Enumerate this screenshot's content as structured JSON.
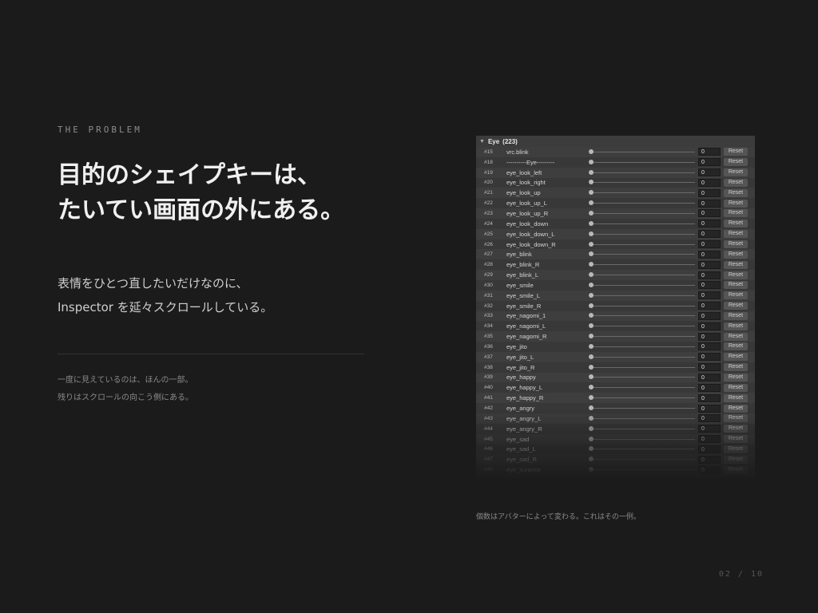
{
  "eyebrow": "THE PROBLEM",
  "headline": {
    "line1": "目的のシェイプキーは、",
    "line2": "たいてい画面の外にある。"
  },
  "lead": {
    "line1": "表情をひとつ直したいだけなのに、",
    "line2": "Inspector を延々スクロールしている。"
  },
  "note": {
    "line1": "一度に見えているのは、ほんの一部。",
    "line2": "残りはスクロールの向こう側にある。"
  },
  "inspector": {
    "group_name": "Eye",
    "group_count": "(223)",
    "reset_label": "Reset",
    "rows": [
      {
        "index": "#15",
        "name": "vrc.blink",
        "value": "0"
      },
      {
        "index": "#18",
        "name": "----------Eye---------",
        "value": "0"
      },
      {
        "index": "#19",
        "name": "eye_look_left",
        "value": "0"
      },
      {
        "index": "#20",
        "name": "eye_look_right",
        "value": "0"
      },
      {
        "index": "#21",
        "name": "eye_look_up",
        "value": "0"
      },
      {
        "index": "#22",
        "name": "eye_look_up_L",
        "value": "0"
      },
      {
        "index": "#23",
        "name": "eye_look_up_R",
        "value": "0"
      },
      {
        "index": "#24",
        "name": "eye_look_down",
        "value": "0"
      },
      {
        "index": "#25",
        "name": "eye_look_down_L",
        "value": "0"
      },
      {
        "index": "#26",
        "name": "eye_look_down_R",
        "value": "0"
      },
      {
        "index": "#27",
        "name": "eye_blink",
        "value": "0"
      },
      {
        "index": "#28",
        "name": "eye_blink_R",
        "value": "0"
      },
      {
        "index": "#29",
        "name": "eye_blink_L",
        "value": "0"
      },
      {
        "index": "#30",
        "name": "eye_smile",
        "value": "0"
      },
      {
        "index": "#31",
        "name": "eye_smile_L",
        "value": "0"
      },
      {
        "index": "#32",
        "name": "eye_smile_R",
        "value": "0"
      },
      {
        "index": "#33",
        "name": "eye_nagomi_1",
        "value": "0"
      },
      {
        "index": "#34",
        "name": "eye_nagomi_L",
        "value": "0"
      },
      {
        "index": "#35",
        "name": "eye_nagomi_R",
        "value": "0"
      },
      {
        "index": "#36",
        "name": "eye_jito",
        "value": "0"
      },
      {
        "index": "#37",
        "name": "eye_jito_L",
        "value": "0"
      },
      {
        "index": "#38",
        "name": "eye_jito_R",
        "value": "0"
      },
      {
        "index": "#39",
        "name": "eye_happy",
        "value": "0"
      },
      {
        "index": "#40",
        "name": "eye_happy_L",
        "value": "0"
      },
      {
        "index": "#41",
        "name": "eye_happy_R",
        "value": "0"
      },
      {
        "index": "#42",
        "name": "eye_angry",
        "value": "0"
      },
      {
        "index": "#43",
        "name": "eye_angry_L",
        "value": "0"
      },
      {
        "index": "#44",
        "name": "eye_angry_R",
        "value": "0"
      },
      {
        "index": "#45",
        "name": "eye_sad",
        "value": "0"
      },
      {
        "index": "#46",
        "name": "eye_sad_L",
        "value": "0"
      },
      {
        "index": "#47",
        "name": "eye_sad_R",
        "value": "0"
      },
      {
        "index": "#48",
        "name": "eye_surprise",
        "value": "0"
      }
    ]
  },
  "caption": "個数はアバターによって変わる。これはその一例。",
  "pager": "02 / 10",
  "colors": {
    "background": "#1b1b1b",
    "panel": "#383838",
    "text": "#e6e6e6"
  },
  "icons": {
    "foldout": "triangle-down-icon",
    "slider_knob": "circle-icon"
  }
}
